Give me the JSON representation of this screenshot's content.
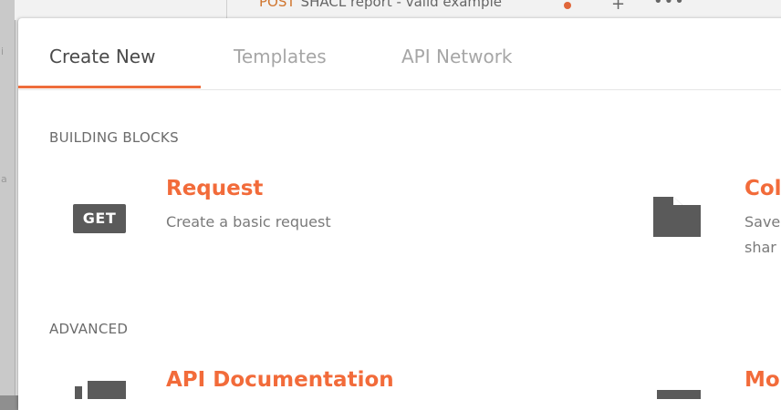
{
  "background": {
    "tab_method": "POST",
    "tab_title": "SHACL report - valid example",
    "plus_glyph": "+",
    "more_glyph": "•••"
  },
  "tabs": [
    {
      "label": "Create New",
      "active": true
    },
    {
      "label": "Templates",
      "active": false
    },
    {
      "label": "API Network",
      "active": false
    }
  ],
  "sections": {
    "building_blocks": "BUILDING BLOCKS",
    "advanced": "ADVANCED"
  },
  "items": {
    "request": {
      "badge": "GET",
      "title": "Request",
      "description": "Create a basic request",
      "icon": "get-badge-icon"
    },
    "collection": {
      "title": "Col",
      "description_line1": "Save",
      "description_line2": "shar",
      "icon": "folder-icon"
    },
    "api_documentation": {
      "title": "API Documentation",
      "icon": "documentation-icon"
    },
    "mock": {
      "title": "Mo",
      "icon": "mock-server-icon"
    }
  },
  "colors": {
    "accent": "#f26b3a",
    "tab_underline": "#ee6d3c",
    "icon_gray": "#5a5a5a",
    "text_muted": "#7a7a7a"
  }
}
